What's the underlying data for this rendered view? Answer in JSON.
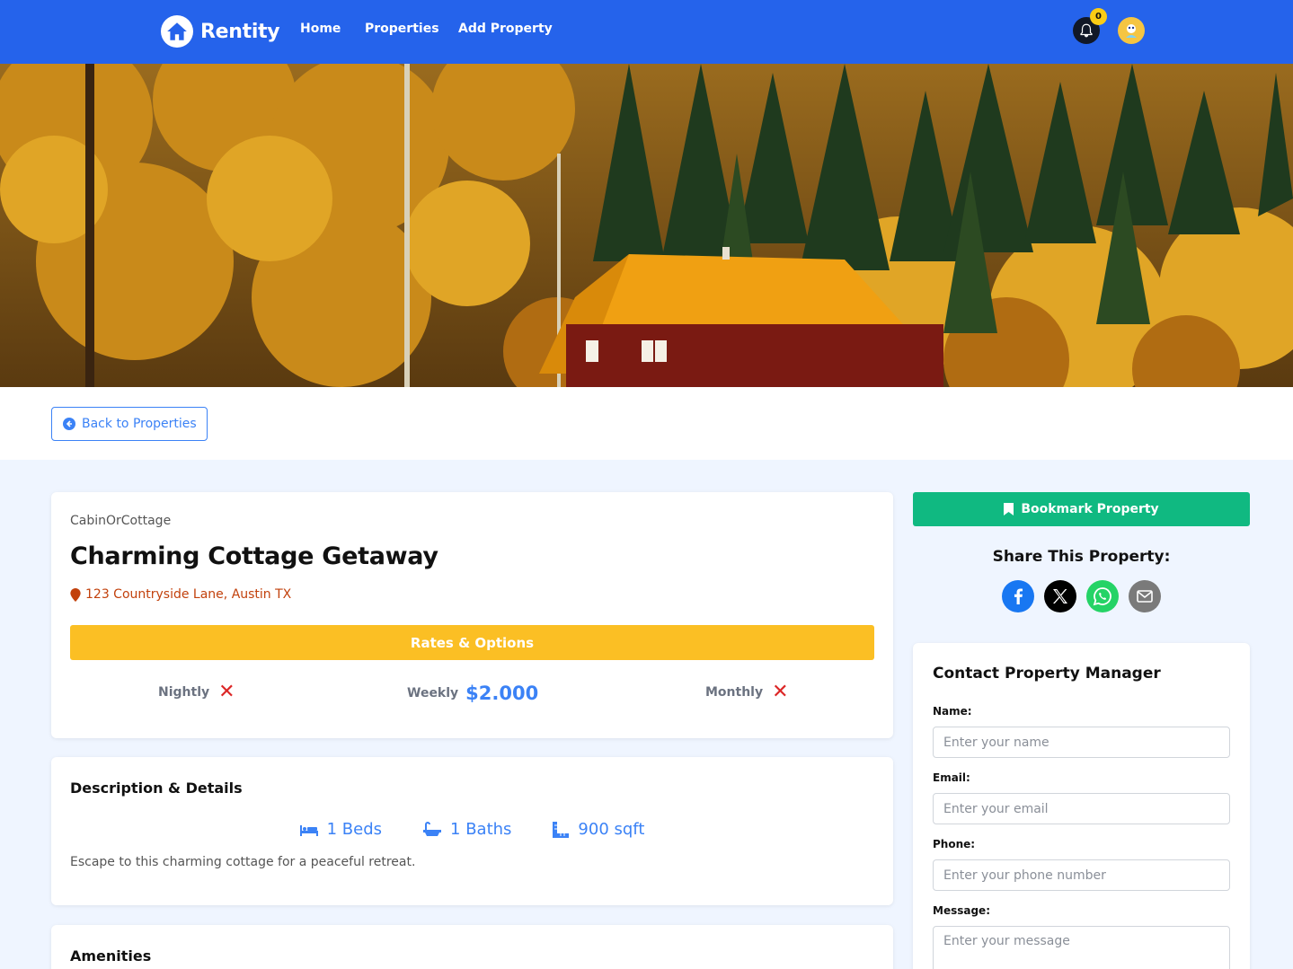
{
  "nav": {
    "brand": "Rentity",
    "links": [
      "Home",
      "Properties",
      "Add Property"
    ],
    "notification_count": "0"
  },
  "back_button": "Back to Properties",
  "property": {
    "type": "CabinOrCottage",
    "title": "Charming Cottage Getaway",
    "address": "123 Countryside Lane, Austin TX",
    "rates_header": "Rates & Options",
    "rates": {
      "nightly_label": "Nightly",
      "weekly_label": "Weekly",
      "weekly_price": "$2.000",
      "monthly_label": "Monthly",
      "unavailable_mark": "✕"
    },
    "details_title": "Description & Details",
    "beds": "1 Beds",
    "baths": "1 Baths",
    "sqft": "900 sqft",
    "description": "Escape to this charming cottage for a peaceful retreat.",
    "amenities_title": "Amenities"
  },
  "sidebar": {
    "bookmark_label": "Bookmark Property",
    "share_title": "Share This Property:",
    "share_icons": [
      "facebook-icon",
      "x-icon",
      "whatsapp-icon",
      "email-icon"
    ],
    "contact": {
      "title": "Contact Property Manager",
      "name_label": "Name:",
      "name_placeholder": "Enter your name",
      "email_label": "Email:",
      "email_placeholder": "Enter your email",
      "phone_label": "Phone:",
      "phone_placeholder": "Enter your phone number",
      "message_label": "Message:",
      "message_placeholder": "Enter your message"
    }
  },
  "colors": {
    "nav_bg": "#2563eb",
    "accent": "#3b82f6",
    "rates_bar": "#fbbf24",
    "bookmark": "#10b981",
    "address": "#c2410c",
    "unavailable": "#dc2626"
  }
}
